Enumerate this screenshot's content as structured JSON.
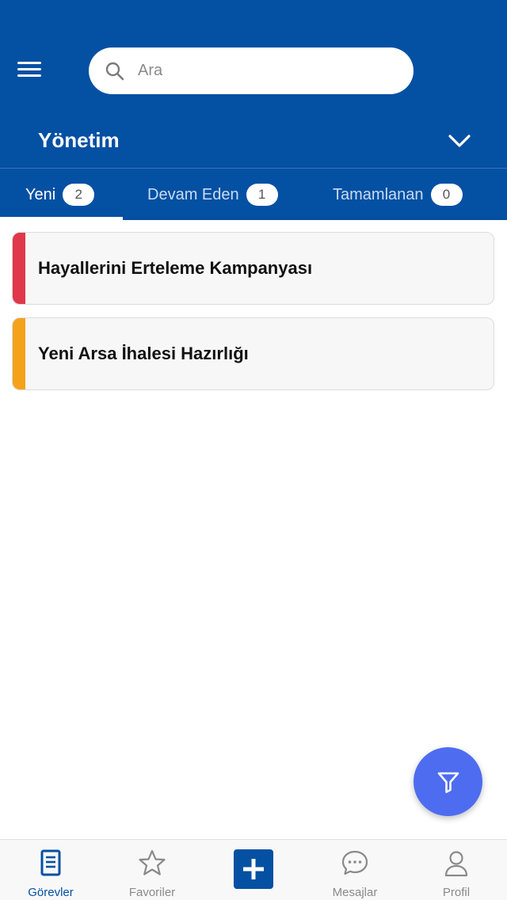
{
  "header": {
    "search_placeholder": "Ara",
    "section_title": "Yönetim",
    "color": "#0450a3"
  },
  "tabs": [
    {
      "label": "Yeni",
      "count": "2",
      "active": true
    },
    {
      "label": "Devam Eden",
      "count": "1",
      "active": false
    },
    {
      "label": "Tamamlanan",
      "count": "0",
      "active": false
    }
  ],
  "tasks": [
    {
      "title": "Hayallerini Erteleme Kampanyası",
      "accent": "#e0384a"
    },
    {
      "title": "Yeni Arsa İhalesi Hazırlığı",
      "accent": "#f5a21b"
    }
  ],
  "fab": {
    "icon": "filter-icon",
    "color": "#4e6cf0"
  },
  "bottom_nav": {
    "items": [
      {
        "label": "Görevler",
        "icon": "document-list-icon",
        "active": true
      },
      {
        "label": "Favoriler",
        "icon": "star-icon",
        "active": false
      },
      {
        "label": "Mesajlar",
        "icon": "chat-bubble-icon",
        "active": false
      },
      {
        "label": "Profil",
        "icon": "person-icon",
        "active": false
      }
    ],
    "add_icon": "plus-icon"
  }
}
